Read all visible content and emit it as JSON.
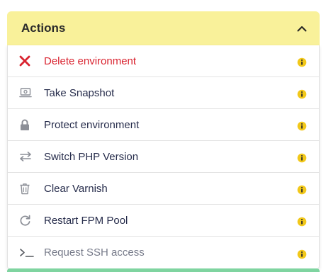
{
  "header": {
    "title": "Actions",
    "toggle_icon": "chevron-up-icon"
  },
  "colors": {
    "header_bg": "#f9f19a",
    "danger": "#d9232f",
    "info_badge": "#f2c81a",
    "icon_gray": "#8c8f97",
    "bottom_strip": "#7fd4a0"
  },
  "actions": [
    {
      "label": "Delete environment",
      "icon": "close-icon",
      "style": "danger"
    },
    {
      "label": "Take Snapshot",
      "icon": "snapshot-icon",
      "style": "normal"
    },
    {
      "label": "Protect environment",
      "icon": "lock-icon",
      "style": "normal"
    },
    {
      "label": "Switch PHP Version",
      "icon": "switch-arrows-icon",
      "style": "normal"
    },
    {
      "label": "Clear Varnish",
      "icon": "trash-icon",
      "style": "normal"
    },
    {
      "label": "Restart FPM Pool",
      "icon": "restart-icon",
      "style": "normal"
    },
    {
      "label": "Request SSH access",
      "icon": "terminal-icon",
      "style": "muted"
    }
  ],
  "info_icon": "info-icon"
}
